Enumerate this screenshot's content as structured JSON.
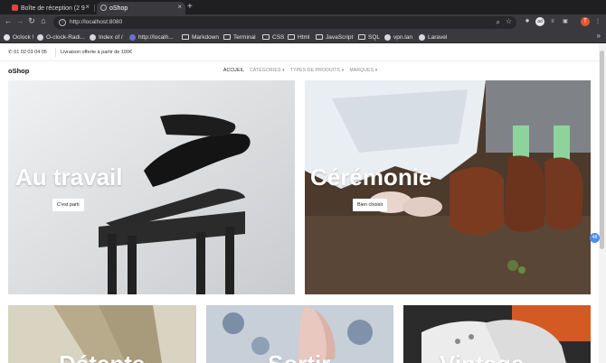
{
  "browser": {
    "tabs": [
      {
        "label": "Boîte de réception (2 9",
        "active": false
      },
      {
        "label": "oShop",
        "active": true
      }
    ],
    "url": "http://localhost:8080",
    "profile_initial": "T",
    "ext_badge": "ad",
    "bookmarks": [
      {
        "label": "Oclock !",
        "kind": "site"
      },
      {
        "label": "O-clock-Radi...",
        "kind": "site"
      },
      {
        "label": "Index of /",
        "kind": "site"
      },
      {
        "label": "http://localh...",
        "kind": "site"
      },
      {
        "label": "Markdown",
        "kind": "folder"
      },
      {
        "label": "Terminal",
        "kind": "folder"
      },
      {
        "label": "CSS",
        "kind": "folder"
      },
      {
        "label": "Html",
        "kind": "folder"
      },
      {
        "label": "JavaScript",
        "kind": "folder"
      },
      {
        "label": "SQL",
        "kind": "folder"
      },
      {
        "label": "vpn.lan",
        "kind": "site"
      },
      {
        "label": "Laravel",
        "kind": "site"
      }
    ],
    "bookmarks_more": "»"
  },
  "site": {
    "topbar": {
      "phone": "01 02 03 04 05",
      "shipping": "Livraison offerte à partir de 100€"
    },
    "brand": "oShop",
    "menu": [
      {
        "label": "ACCUEIL",
        "active": true
      },
      {
        "label": "CATÉGORIES ▾",
        "active": false
      },
      {
        "label": "TYPES DE PRODUITS ▾",
        "active": false
      },
      {
        "label": "MARQUES ▾",
        "active": false
      }
    ],
    "cards": [
      {
        "title": "Au travail",
        "button": "C'est parti"
      },
      {
        "title": "Cérémonie",
        "button": "Bien choisir"
      },
      {
        "title": "Détente",
        "button": ""
      },
      {
        "title": "Sortir",
        "button": ""
      },
      {
        "title": "Vintage",
        "button": ""
      }
    ],
    "float_badge": "48"
  },
  "colors": {
    "accent": "#4d8ef0",
    "browser_dark": "#1f1f22",
    "toolbar": "#3a3a3e"
  }
}
